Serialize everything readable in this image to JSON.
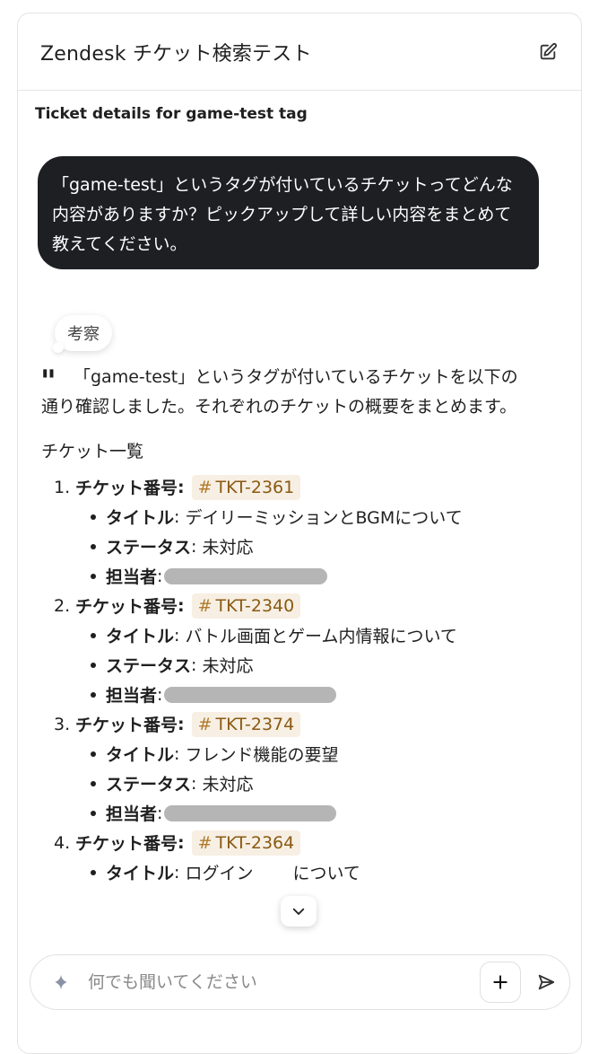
{
  "header": {
    "title": "Zendesk チケット検索テスト",
    "edit_icon": "edit-icon"
  },
  "thread_title": "Ticket details for game-test tag",
  "user_message": "「game-test」というタグが付いているチケットってどんな内容がありますか？ピックアップして詳しい内容をまとめて教えてください。",
  "thinking_chip": "考察",
  "answer": {
    "intro": "「game-test」というタグが付いているチケットを以下の通り確認しました。それぞれのチケットの概要をまとめます。",
    "list_heading": "チケット一覧",
    "ticket_label": "チケット番号",
    "title_label": "タイトル",
    "status_label": "ステータス",
    "assignee_label": "担当者",
    "tickets": [
      {
        "num": "1.",
        "id": "TKT-2361",
        "title": "デイリーミッションとBGMについて",
        "status": "未対応"
      },
      {
        "num": "2.",
        "id": "TKT-2340",
        "title": "バトル画面とゲーム内情報について",
        "status": "未対応"
      },
      {
        "num": "3.",
        "id": "TKT-2374",
        "title": "フレンド機能の要望",
        "status": "未対応"
      },
      {
        "num": "4.",
        "id": "TKT-2364",
        "title_prefix": "ログイン",
        "title_suffix": "について"
      }
    ]
  },
  "composer": {
    "placeholder": "何でも聞いてください"
  },
  "colors": {
    "user_bubble": "#1d1f23",
    "tag_bg": "#f7efe3",
    "tag_text": "#8a5a14"
  }
}
